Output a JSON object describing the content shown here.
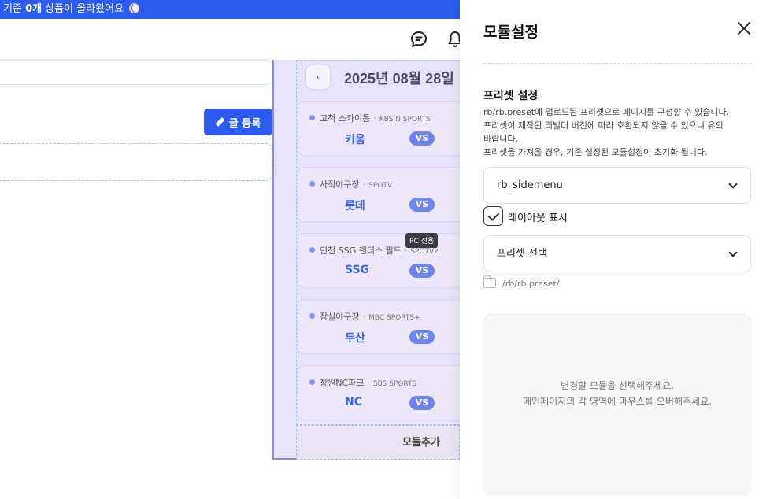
{
  "banner": {
    "text_prefix": "기준 ",
    "count": "0개",
    "text_suffix": " 상품이 올라왔어요"
  },
  "left": {
    "post_button": "글 등록"
  },
  "widget": {
    "date": "2025년 08월 28일",
    "prev_label": "‹",
    "tooltip": "PC 전용",
    "add_module": "모듈추가",
    "games": [
      {
        "venue": "고척 스카이돔",
        "broadcast": "KBS N SPORTS",
        "team": "키움",
        "vs": "VS"
      },
      {
        "venue": "사직야구장",
        "broadcast": "SPOTV",
        "team": "롯데",
        "vs": "VS"
      },
      {
        "venue": "인천 SSG 랜더스 필드",
        "broadcast": "SPOTV2",
        "team": "SSG",
        "vs": "VS"
      },
      {
        "venue": "잠실야구장",
        "broadcast": "MBC SPORTS+",
        "team": "두산",
        "vs": "VS"
      },
      {
        "venue": "창원NC파크",
        "broadcast": "SBS SPORTS",
        "team": "NC",
        "vs": "VS"
      }
    ]
  },
  "panel": {
    "title": "모듈설정",
    "section_title": "프리셋 설정",
    "desc_lines": [
      "rb/rb.preset에 업로드된 프리셋으로 페이지를 구성할 수 있습니다.",
      "프리셋이 제작된 리빌더 버전에 따라 호환되지 않을 수 있으니 유의",
      "바랍니다.",
      "프리셋을 가져올 경우, 기존 설정된 모듈설정이 초기화 됩니다."
    ],
    "select_theme": "rb_sidemenu",
    "layout_checkbox_label": "레이아웃 표시",
    "layout_checked": true,
    "select_preset": "프리셋 선택",
    "folder_path": "/rb/rb.preset/",
    "empty_lines": [
      "변경할 모듈을 선택해주세요.",
      "메인페이지의 각 영역에 마우스를 오버해주세요."
    ]
  },
  "colors": {
    "accent": "#2c5bf0",
    "widget_bg": "#e7e3f8",
    "team": "#3c63e6",
    "vs_badge": "#6f84ec"
  }
}
